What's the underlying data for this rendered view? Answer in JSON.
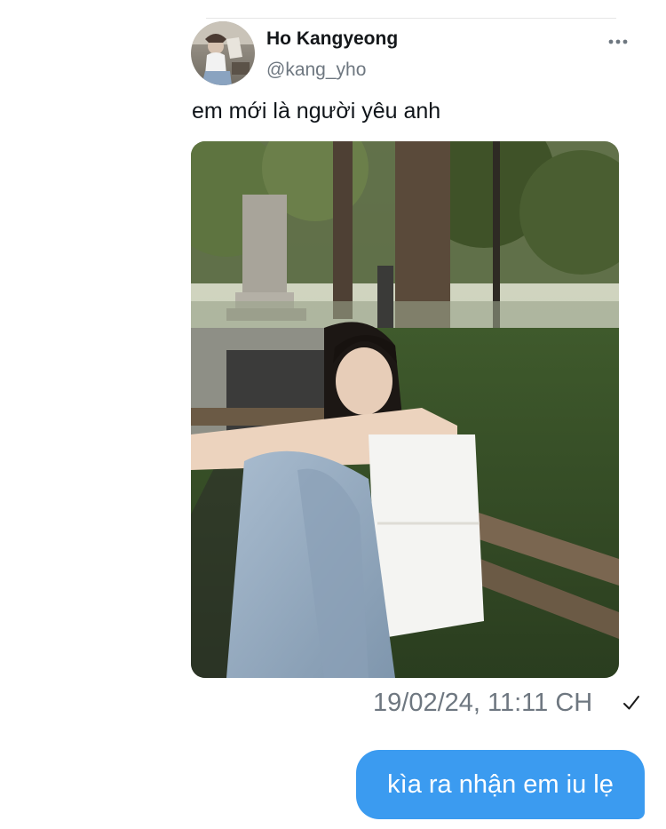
{
  "tweet": {
    "author_name": "Ho Kangyeong",
    "author_handle": "@kang_yho",
    "text": "em mới là người yêu anh",
    "avatar_icon": "profile-photo",
    "more_icon": "ellipsis-icon",
    "photo_description_icon": "park-bench-photo"
  },
  "message_meta": {
    "timestamp": "19/02/24, 11:11 CH",
    "status_icon": "checkmark-icon"
  },
  "reply": {
    "text": "kìa ra nhận em iu lẹ"
  },
  "colors": {
    "bubble": "#3b9bf0",
    "secondary_text": "#6e7780",
    "primary_text": "#0f1419"
  }
}
